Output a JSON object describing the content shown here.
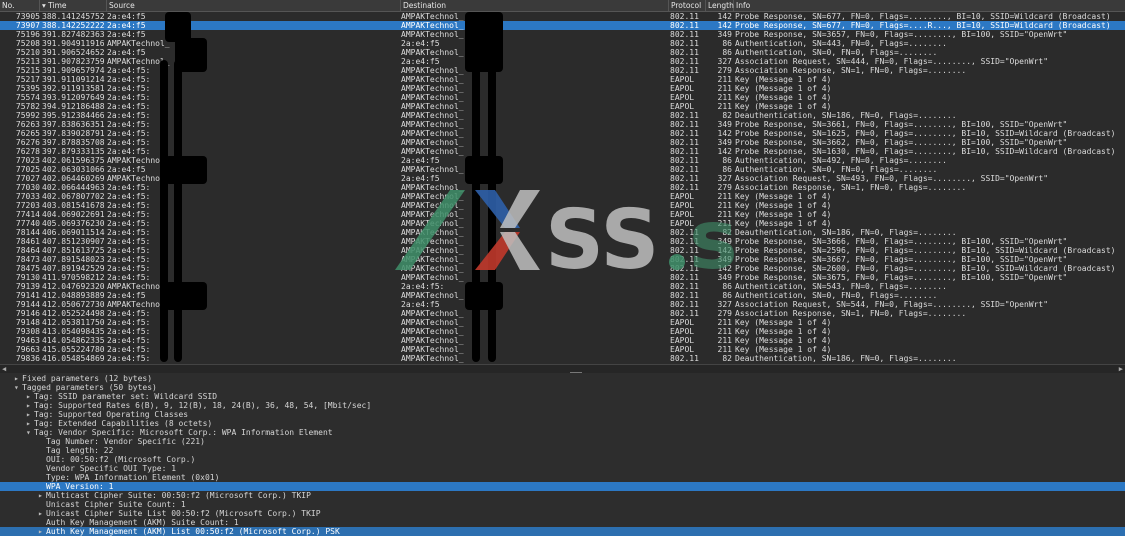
{
  "columns": {
    "no": "No.",
    "time": "Time",
    "source": "Source",
    "destination": "Destination",
    "protocol": "Protocol",
    "length": "Length",
    "info": "Info"
  },
  "packets": [
    {
      "no": "73905",
      "time": "388.141245752",
      "src": "2a:e4:f5",
      "dst": "AMPAKTechnol_",
      "proto": "802.11",
      "len": "142",
      "info": "Probe Response, SN=677, FN=0, Flags=........, BI=10, SSID=Wildcard (Broadcast)"
    },
    {
      "no": "73907",
      "time": "388.142252222",
      "src": "2a:e4:f5",
      "dst": "AMPAKTechnol_",
      "proto": "802.11",
      "len": "142",
      "info": "Probe Response, SN=677, FN=0, Flags=....R..., BI=10, SSID=Wildcard (Broadcast)",
      "selected": true
    },
    {
      "no": "75196",
      "time": "391.827482363",
      "src": "2a:e4:f5",
      "dst": "AMPAKTechnol_",
      "proto": "802.11",
      "len": "349",
      "info": "Probe Response, SN=3657, FN=0, Flags=........, BI=100, SSID=\"OpenWrt\""
    },
    {
      "no": "75208",
      "time": "391.904911916",
      "src": "AMPAKTechnol_",
      "dst": "2a:e4:f5",
      "proto": "802.11",
      "len": "86",
      "info": "Authentication, SN=443, FN=0, Flags=........"
    },
    {
      "no": "75210",
      "time": "391.906524652",
      "src": "2a:e4:f5",
      "dst": "AMPAKTechnol_",
      "proto": "802.11",
      "len": "86",
      "info": "Authentication, SN=0, FN=0, Flags=........"
    },
    {
      "no": "75213",
      "time": "391.907823759",
      "src": "AMPAKTechnol_",
      "dst": "2a:e4:f5",
      "proto": "802.11",
      "len": "327",
      "info": "Association Request, SN=444, FN=0, Flags=........, SSID=\"OpenWrt\""
    },
    {
      "no": "75215",
      "time": "391.909657974",
      "src": "2a:e4:f5:",
      "dst": "AMPAKTechnol_",
      "proto": "802.11",
      "len": "279",
      "info": "Association Response, SN=1, FN=0, Flags=........"
    },
    {
      "no": "75217",
      "time": "391.911091214",
      "src": "2a:e4:f5:",
      "dst": "AMPAKTechnol_",
      "proto": "EAPOL",
      "len": "211",
      "info": "Key (Message 1 of 4)"
    },
    {
      "no": "75395",
      "time": "392.911913581",
      "src": "2a:e4:f5:",
      "dst": "AMPAKTechnol_",
      "proto": "EAPOL",
      "len": "211",
      "info": "Key (Message 1 of 4)"
    },
    {
      "no": "75574",
      "time": "393.912097649",
      "src": "2a:e4:f5:",
      "dst": "AMPAKTechnol_",
      "proto": "EAPOL",
      "len": "211",
      "info": "Key (Message 1 of 4)"
    },
    {
      "no": "75782",
      "time": "394.912186488",
      "src": "2a:e4:f5:",
      "dst": "AMPAKTechnol_",
      "proto": "EAPOL",
      "len": "211",
      "info": "Key (Message 1 of 4)"
    },
    {
      "no": "75992",
      "time": "395.912384466",
      "src": "2a:e4:f5:",
      "dst": "AMPAKTechnol_",
      "proto": "802.11",
      "len": "82",
      "info": "Deauthentication, SN=186, FN=0, Flags=........"
    },
    {
      "no": "76263",
      "time": "397.838636351",
      "src": "2a:e4:f5:",
      "dst": "AMPAKTechnol_",
      "proto": "802.11",
      "len": "349",
      "info": "Probe Response, SN=3661, FN=0, Flags=........, BI=100, SSID=\"OpenWrt\""
    },
    {
      "no": "76265",
      "time": "397.839028791",
      "src": "2a:e4:f5:",
      "dst": "AMPAKTechnol_",
      "proto": "802.11",
      "len": "142",
      "info": "Probe Response, SN=1625, FN=0, Flags=........, BI=10, SSID=Wildcard (Broadcast)"
    },
    {
      "no": "76276",
      "time": "397.878835708",
      "src": "2a:e4:f5:",
      "dst": "AMPAKTechnol_",
      "proto": "802.11",
      "len": "349",
      "info": "Probe Response, SN=3662, FN=0, Flags=........, BI=100, SSID=\"OpenWrt\""
    },
    {
      "no": "76278",
      "time": "397.879333135",
      "src": "2a:e4:f5:",
      "dst": "AMPAKTechnol_",
      "proto": "802.11",
      "len": "142",
      "info": "Probe Response, SN=1630, FN=0, Flags=........, BI=10, SSID=Wildcard (Broadcast)"
    },
    {
      "no": "77023",
      "time": "402.061596375",
      "src": "AMPAKTechnol_",
      "dst": "2a:e4:f5",
      "proto": "802.11",
      "len": "86",
      "info": "Authentication, SN=492, FN=0, Flags=........"
    },
    {
      "no": "77025",
      "time": "402.063031066",
      "src": "2a:e4:f5",
      "dst": "AMPAKTechnol_",
      "proto": "802.11",
      "len": "86",
      "info": "Authentication, SN=0, FN=0, Flags=........"
    },
    {
      "no": "77027",
      "time": "402.064460269",
      "src": "AMPAKTechnol_",
      "dst": "2a:e4:f5",
      "proto": "802.11",
      "len": "327",
      "info": "Association Request, SN=493, FN=0, Flags=........, SSID=\"OpenWrt\""
    },
    {
      "no": "77030",
      "time": "402.066444963",
      "src": "2a:e4:f5:",
      "dst": "AMPAKTechnol_",
      "proto": "802.11",
      "len": "279",
      "info": "Association Response, SN=1, FN=0, Flags=........"
    },
    {
      "no": "77033",
      "time": "402.067807702",
      "src": "2a:e4:f5:",
      "dst": "AMPAKTechnol_",
      "proto": "EAPOL",
      "len": "211",
      "info": "Key (Message 1 of 4)"
    },
    {
      "no": "77203",
      "time": "403.081541678",
      "src": "2a:e4:f5:",
      "dst": "AMPAKTechnol_",
      "proto": "EAPOL",
      "len": "211",
      "info": "Key (Message 1 of 4)"
    },
    {
      "no": "77414",
      "time": "404.069022691",
      "src": "2a:e4:f5:",
      "dst": "AMPAKTechnol_",
      "proto": "EAPOL",
      "len": "211",
      "info": "Key (Message 1 of 4)"
    },
    {
      "no": "77740",
      "time": "405.069376230",
      "src": "2a:e4:f5:",
      "dst": "AMPAKTechnol_",
      "proto": "EAPOL",
      "len": "211",
      "info": "Key (Message 1 of 4)"
    },
    {
      "no": "78144",
      "time": "406.069011514",
      "src": "2a:e4:f5:",
      "dst": "AMPAKTechnol_",
      "proto": "802.11",
      "len": "82",
      "info": "Deauthentication, SN=186, FN=0, Flags=........"
    },
    {
      "no": "78461",
      "time": "407.851230907",
      "src": "2a:e4:f5:",
      "dst": "AMPAKTechnol_",
      "proto": "802.11",
      "len": "349",
      "info": "Probe Response, SN=3666, FN=0, Flags=........, BI=100, SSID=\"OpenWrt\""
    },
    {
      "no": "78464",
      "time": "407.851613725",
      "src": "2a:e4:f5:",
      "dst": "AMPAKTechnol_",
      "proto": "802.11",
      "len": "142",
      "info": "Probe Response, SN=2596, FN=0, Flags=........, BI=10, SSID=Wildcard (Broadcast)"
    },
    {
      "no": "78473",
      "time": "407.891548023",
      "src": "2a:e4:f5:",
      "dst": "AMPAKTechnol_",
      "proto": "802.11",
      "len": "349",
      "info": "Probe Response, SN=3667, FN=0, Flags=........, BI=100, SSID=\"OpenWrt\""
    },
    {
      "no": "78475",
      "time": "407.891942529",
      "src": "2a:e4:f5:",
      "dst": "AMPAKTechnol_",
      "proto": "802.11",
      "len": "142",
      "info": "Probe Response, SN=2600, FN=0, Flags=........, BI=10, SSID=Wildcard (Broadcast)"
    },
    {
      "no": "79130",
      "time": "411.970598212",
      "src": "2a:e4:f5:",
      "dst": "AMPAKTechnol_",
      "proto": "802.11",
      "len": "349",
      "info": "Probe Response, SN=3675, FN=0, Flags=........, BI=100, SSID=\"OpenWrt\""
    },
    {
      "no": "79139",
      "time": "412.047692320",
      "src": "AMPAKTechnol_",
      "dst": "2a:e4:f5:",
      "proto": "802.11",
      "len": "86",
      "info": "Authentication, SN=543, FN=0, Flags=........"
    },
    {
      "no": "79141",
      "time": "412.048893889",
      "src": "2a:e4:f5",
      "dst": "AMPAKTechnol_",
      "proto": "802.11",
      "len": "86",
      "info": "Authentication, SN=0, FN=0, Flags=........"
    },
    {
      "no": "79144",
      "time": "412.050672730",
      "src": "AMPAKTechnol_",
      "dst": "2a:e4:f5",
      "proto": "802.11",
      "len": "327",
      "info": "Association Request, SN=544, FN=0, Flags=........, SSID=\"OpenWrt\""
    },
    {
      "no": "79146",
      "time": "412.052524498",
      "src": "2a:e4:f5:",
      "dst": "AMPAKTechnol_",
      "proto": "802.11",
      "len": "279",
      "info": "Association Response, SN=1, FN=0, Flags=........"
    },
    {
      "no": "79148",
      "time": "412.053811750",
      "src": "2a:e4:f5:",
      "dst": "AMPAKTechnol_",
      "proto": "EAPOL",
      "len": "211",
      "info": "Key (Message 1 of 4)"
    },
    {
      "no": "79308",
      "time": "413.054098435",
      "src": "2a:e4:f5:",
      "dst": "AMPAKTechnol_",
      "proto": "EAPOL",
      "len": "211",
      "info": "Key (Message 1 of 4)"
    },
    {
      "no": "79463",
      "time": "414.054862335",
      "src": "2a:e4:f5:",
      "dst": "AMPAKTechnol_",
      "proto": "EAPOL",
      "len": "211",
      "info": "Key (Message 1 of 4)"
    },
    {
      "no": "79663",
      "time": "415.055224780",
      "src": "2a:e4:f5:",
      "dst": "AMPAKTechnol_",
      "proto": "EAPOL",
      "len": "211",
      "info": "Key (Message 1 of 4)"
    },
    {
      "no": "79836",
      "time": "416.054854869",
      "src": "2a:e4:f5:",
      "dst": "AMPAKTechnol_",
      "proto": "802.11",
      "len": "82",
      "info": "Deauthentication, SN=186, FN=0, Flags=........"
    }
  ],
  "details": [
    {
      "indent": 1,
      "toggle": "collapsed",
      "text": "Fixed parameters (12 bytes)"
    },
    {
      "indent": 1,
      "toggle": "expanded",
      "text": "Tagged parameters (50 bytes)"
    },
    {
      "indent": 2,
      "toggle": "collapsed",
      "text": "Tag: SSID parameter set: Wildcard SSID"
    },
    {
      "indent": 2,
      "toggle": "collapsed",
      "text": "Tag: Supported Rates 6(B), 9, 12(B), 18, 24(B), 36, 48, 54, [Mbit/sec]"
    },
    {
      "indent": 2,
      "toggle": "collapsed",
      "text": "Tag: Supported Operating Classes"
    },
    {
      "indent": 2,
      "toggle": "collapsed",
      "text": "Tag: Extended Capabilities (8 octets)"
    },
    {
      "indent": 2,
      "toggle": "expanded",
      "text": "Tag: Vendor Specific: Microsoft Corp.: WPA Information Element"
    },
    {
      "indent": 3,
      "toggle": "none",
      "text": "Tag Number: Vendor Specific (221)"
    },
    {
      "indent": 3,
      "toggle": "none",
      "text": "Tag length: 22"
    },
    {
      "indent": 3,
      "toggle": "none",
      "text": "OUI: 00:50:f2 (Microsoft Corp.)"
    },
    {
      "indent": 3,
      "toggle": "none",
      "text": "Vendor Specific OUI Type: 1"
    },
    {
      "indent": 3,
      "toggle": "none",
      "text": "Type: WPA Information Element (0x01)"
    },
    {
      "indent": 3,
      "toggle": "none",
      "text": "WPA Version: 1",
      "selected": true
    },
    {
      "indent": 3,
      "toggle": "collapsed",
      "text": "Multicast Cipher Suite: 00:50:f2 (Microsoft Corp.) TKIP"
    },
    {
      "indent": 3,
      "toggle": "none",
      "text": "Unicast Cipher Suite Count: 1"
    },
    {
      "indent": 3,
      "toggle": "collapsed",
      "text": "Unicast Cipher Suite List 00:50:f2 (Microsoft Corp.) TKIP"
    },
    {
      "indent": 3,
      "toggle": "none",
      "text": "Auth Key Management (AKM) Suite Count: 1"
    },
    {
      "indent": 3,
      "toggle": "collapsed",
      "text": "Auth Key Management (AKM) List 00:50:f2 (Microsoft Corp.) PSK",
      "selected2": true
    }
  ],
  "watermark": {
    "text": "XSS.is",
    "colors": {
      "slash": "#3f8f6a",
      "x_left": "#c0392b",
      "x_right": "#2e5fa8",
      "letters": "#bfbfbf",
      "dot": "#3f8f6a"
    }
  },
  "colors": {
    "selection": "#2c78c4",
    "background": "#2b2b2b",
    "redaction": "#000000"
  }
}
